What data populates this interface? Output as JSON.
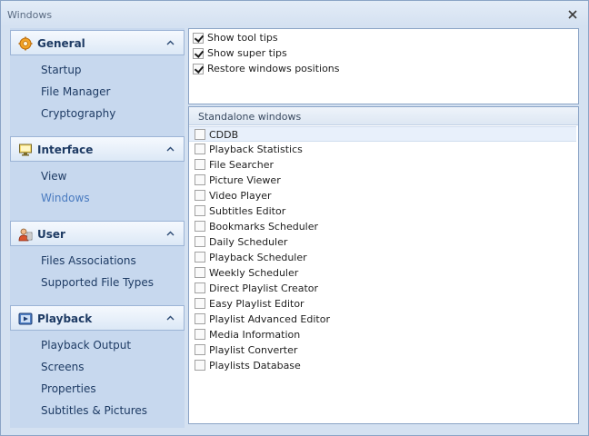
{
  "window": {
    "title": "Windows"
  },
  "sidebar": {
    "groups": [
      {
        "label": "General",
        "icon": "gear-icon",
        "items": [
          "Startup",
          "File Manager",
          "Cryptography"
        ]
      },
      {
        "label": "Interface",
        "icon": "monitor-icon",
        "items": [
          "View",
          "Windows"
        ]
      },
      {
        "label": "User",
        "icon": "user-icon",
        "items": [
          "Files Associations",
          "Supported File Types"
        ]
      },
      {
        "label": "Playback",
        "icon": "playback-icon",
        "items": [
          "Playback Output",
          "Screens",
          "Properties",
          "Subtitles & Pictures"
        ]
      }
    ],
    "selected": "Windows"
  },
  "options": [
    {
      "label": "Show tool tips",
      "checked": true
    },
    {
      "label": "Show super tips",
      "checked": true
    },
    {
      "label": "Restore windows positions",
      "checked": true
    }
  ],
  "standalone": {
    "header": "Standalone windows",
    "items": [
      {
        "label": "CDDB",
        "checked": false
      },
      {
        "label": "Playback Statistics",
        "checked": false
      },
      {
        "label": "File Searcher",
        "checked": false
      },
      {
        "label": "Picture Viewer",
        "checked": false
      },
      {
        "label": "Video Player",
        "checked": false
      },
      {
        "label": "Subtitles Editor",
        "checked": false
      },
      {
        "label": "Bookmarks Scheduler",
        "checked": false
      },
      {
        "label": "Daily Scheduler",
        "checked": false
      },
      {
        "label": "Playback Scheduler",
        "checked": false
      },
      {
        "label": "Weekly Scheduler",
        "checked": false
      },
      {
        "label": "Direct Playlist Creator",
        "checked": false
      },
      {
        "label": "Easy Playlist Editor",
        "checked": false
      },
      {
        "label": "Playlist Advanced Editor",
        "checked": false
      },
      {
        "label": "Media Information",
        "checked": false
      },
      {
        "label": "Playlist Converter",
        "checked": false
      },
      {
        "label": "Playlists Database",
        "checked": false
      }
    ]
  },
  "colors": {
    "accent": "#4a7bc0",
    "group_text": "#1e3b64",
    "panel_border": "#8ba4c6"
  }
}
